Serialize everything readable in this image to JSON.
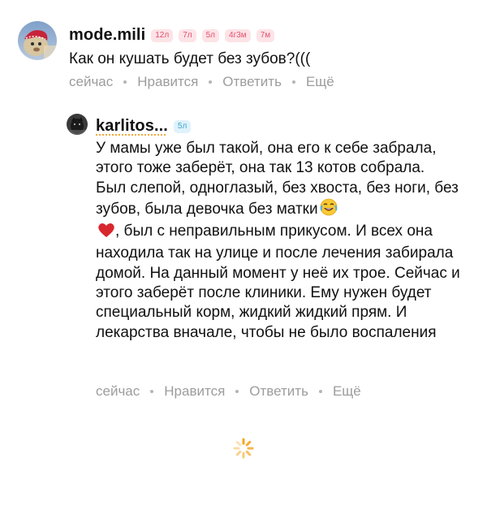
{
  "comments": [
    {
      "username": "mode.mili",
      "badges": [
        "12л",
        "7л",
        "5л",
        "4г3м",
        "7м"
      ],
      "text": "Как он кушать будет без зубов?(((",
      "time": "сейчас",
      "like_label": "Нравится",
      "reply_label": "Ответить",
      "more_label": "Ещё"
    },
    {
      "username": "karlitos...",
      "badges": [
        "5л"
      ],
      "paragraph1": "У мамы уже был такой, она его к себе забрала, этого тоже заберёт, она так 13 котов собрала.",
      "paragraph2_part1": "Был слепой, одноглазый, без хвоста, без ноги, без зубов, была девочка без матки",
      "emoji_laugh": "😂",
      "emoji_heart": "❤️",
      "paragraph2_part2": ", был с неправильным прикусом. И всех она находила так на улице и после лечения забирала домой. На данный момент у неё их трое. Сейчас и этого заберёт после клиники. Ему нужен будет специальный корм, жидкий жидкий прям. И лекарства вначале, чтобы не было воспаления",
      "time": "сейчас",
      "like_label": "Нравится",
      "reply_label": "Ответить",
      "more_label": "Ещё"
    }
  ],
  "icons": {
    "avatar1": "avatar-photo-red-bandana",
    "avatar2": "avatar-photo-dark",
    "loading": "loading-spinner-icon"
  },
  "colors": {
    "badge_pink_bg": "#fde3e7",
    "badge_pink_text": "#e0506c",
    "badge_blue_bg": "#dff2fb",
    "badge_blue_text": "#3ea6cf",
    "meta_text": "#9c9c9c",
    "spinner": "#f5a623"
  }
}
